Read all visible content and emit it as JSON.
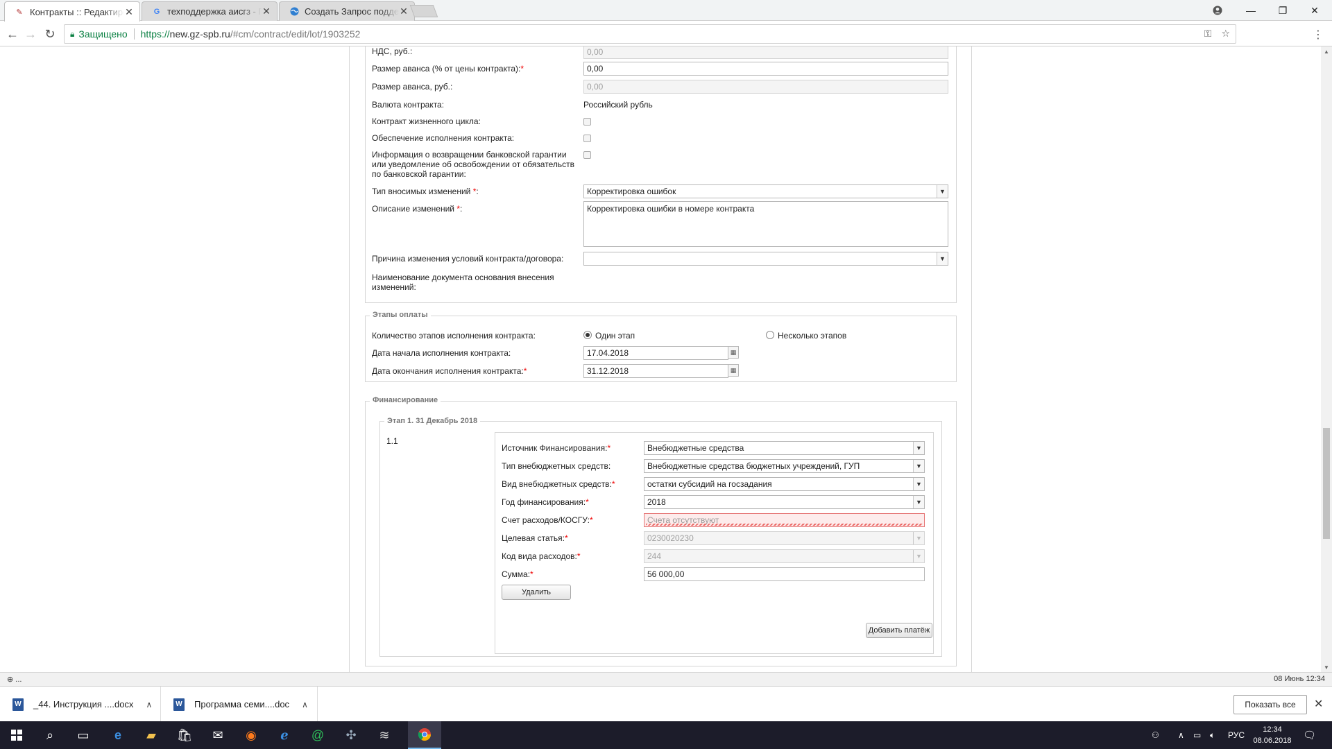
{
  "browser": {
    "tabs": [
      {
        "title": "Контракты :: Редактирование",
        "icon": "tools-icon"
      },
      {
        "title": "техподдержка аисгз - Поиск в Google",
        "icon": "google-icon"
      },
      {
        "title": "Создать Запрос поддержки",
        "icon": "globe-icon"
      }
    ],
    "address": {
      "secure_label": "Защищено",
      "url_scheme": "https://",
      "url_host": "new.gz-spb.ru",
      "url_path": "/#cm/contract/edit/lot/1903252"
    }
  },
  "form": {
    "top_fields": [
      {
        "label": "НДС, руб.:",
        "value": "0,00"
      },
      {
        "label": "Размер аванса (% от цены контракта):",
        "required": "*",
        "value": "0,00"
      },
      {
        "label": "Размер аванса, руб.:",
        "value": "0,00"
      }
    ],
    "currency": {
      "label": "Валюта контракта:",
      "value": "Российский рубль"
    },
    "checkboxes": [
      {
        "label": "Контракт жизненного цикла:"
      },
      {
        "label": "Обеспечение исполнения контракта:"
      },
      {
        "label": "Информация о возвращении банковской гарантии или уведомление об освобождении от обязательств по банковской гарантии:"
      }
    ],
    "change_type": {
      "label": "Тип вносимых изменений ",
      "required": "*",
      "suffix": ":",
      "value": "Корректировка ошибок"
    },
    "change_desc": {
      "label": "Описание изменений ",
      "required": "*",
      "suffix": ":",
      "value": "Корректировка ошибки в номере контракта"
    },
    "change_reason": {
      "label": "Причина изменения условий контракта/договора:",
      "value": ""
    },
    "doc_name": {
      "label": "Наименование документа основания внесения изменений:"
    }
  },
  "payment_stages": {
    "legend": "Этапы оплаты",
    "count_label": "Количество этапов исполнения контракта:",
    "option_one": "Один этап",
    "option_many": "Несколько этапов",
    "start_label": "Дата начала исполнения контракта:",
    "start_value": "17.04.2018",
    "end_label": "Дата окончания исполнения контракта:",
    "end_required": "*",
    "end_value": "31.12.2018"
  },
  "financing": {
    "legend": "Финансирование",
    "stage_legend": "Этап 1. 31 Декабрь 2018",
    "row_number": "1.1",
    "fields": [
      {
        "label": "Источник Финансирования:",
        "required": "*",
        "value": "Внебюджетные средства"
      },
      {
        "label": "Тип внебюджетных средств:",
        "required": "",
        "value": "Внебюджетные средства бюджетных учреждений, ГУП"
      },
      {
        "label": "Вид внебюджетных средств:",
        "required": "*",
        "value": "остатки субсидий на госзадания"
      },
      {
        "label": "Год финансирования:",
        "required": "*",
        "value": "2018"
      },
      {
        "label": "Счет расходов/КОСГУ:",
        "required": "*",
        "value": "Счета отсутствуют"
      },
      {
        "label": "Целевая статья:",
        "required": "*",
        "value": "0230020230"
      },
      {
        "label": "Код вида расходов:",
        "required": "*",
        "value": "244"
      },
      {
        "label": "Сумма:",
        "required": "*",
        "value": "56 000,00"
      }
    ],
    "delete_label": "Удалить",
    "add_payment_label": "Добавить платёж"
  },
  "statusbar": {
    "left": "⊕ ...",
    "right": "08 Июнь 12:34"
  },
  "downloads": [
    {
      "name": "_44. Инструкция ....docx"
    },
    {
      "name": "Программа семи....doc"
    }
  ],
  "show_all_label": "Показать все",
  "taskbar": {
    "lang": "РУС",
    "time": "12:34",
    "date": "08.06.2018"
  }
}
